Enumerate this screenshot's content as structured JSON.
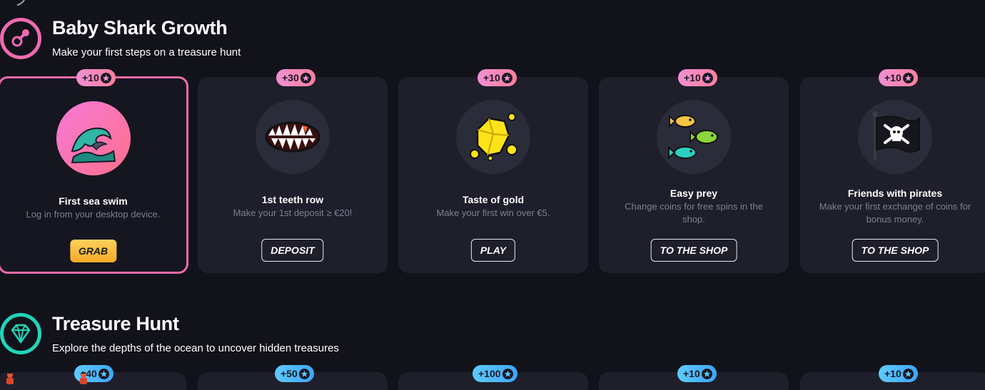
{
  "sections": [
    {
      "title": "Baby Shark Growth",
      "subtitle": "Make your first steps on a treasure hunt",
      "icon": "pacifier-icon",
      "color": "#f06ab0"
    },
    {
      "title": "Treasure Hunt",
      "subtitle": "Explore the depths of the ocean to uncover hidden treasures",
      "icon": "diamond-icon",
      "color": "#1fd5b8"
    }
  ],
  "cards": [
    {
      "reward": "+10",
      "title": "First sea swim",
      "desc": "Log in from your desktop device.",
      "button": "GRAB",
      "icon": "wave-icon"
    },
    {
      "reward": "+30",
      "title": "1st teeth row",
      "desc": "Make your 1st deposit ≥ €20!",
      "button": "DEPOSIT",
      "icon": "shark-teeth-icon"
    },
    {
      "reward": "+10",
      "title": "Taste of gold",
      "desc": "Make your first win over €5.",
      "button": "PLAY",
      "icon": "gold-nugget-icon"
    },
    {
      "reward": "+10",
      "title": "Easy prey",
      "desc": "Change coins for free spins in the shop.",
      "button": "TO THE SHOP",
      "icon": "fish-icon"
    },
    {
      "reward": "+10",
      "title": "Friends with pirates",
      "desc": "Make your first exchange of coins for bonus money.",
      "button": "TO THE SHOP",
      "icon": "pirate-flag-icon"
    }
  ],
  "treasure_rewards": [
    "+40",
    "+50",
    "+100",
    "+10",
    "+10"
  ]
}
